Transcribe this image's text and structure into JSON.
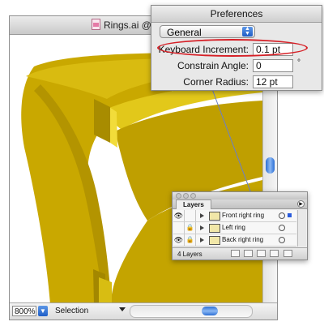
{
  "document": {
    "title": "Rings.ai @",
    "zoom": "800%",
    "status_label": "Selection"
  },
  "preferences": {
    "title": "Preferences",
    "section": "General",
    "fields": [
      {
        "label": "Keyboard Increment:",
        "value": "0.1 pt",
        "unit": ""
      },
      {
        "label": "Constrain Angle:",
        "value": "0",
        "unit": "°"
      },
      {
        "label": "Corner Radius:",
        "value": "12 pt",
        "unit": ""
      }
    ]
  },
  "layers_panel": {
    "tab": "Layers",
    "count": "4 Layers",
    "layers": [
      {
        "name": "Front right ring",
        "visible": true,
        "locked": false,
        "selected": true
      },
      {
        "name": "Left ring",
        "visible": false,
        "locked": true,
        "selected": false
      },
      {
        "name": "Back right ring",
        "visible": true,
        "locked": true,
        "selected": false
      }
    ]
  },
  "colors": {
    "ring_gold": "#c9a800",
    "ring_highlight": "#e9cf1e",
    "highlight_oval": "#d61f26",
    "accent_blue": "#2c6fd6"
  },
  "icons": [
    "ai-file-icon",
    "eye-icon",
    "lock-icon",
    "disclosure-arrow-icon",
    "target-circle-icon",
    "panel-menu-icon"
  ]
}
